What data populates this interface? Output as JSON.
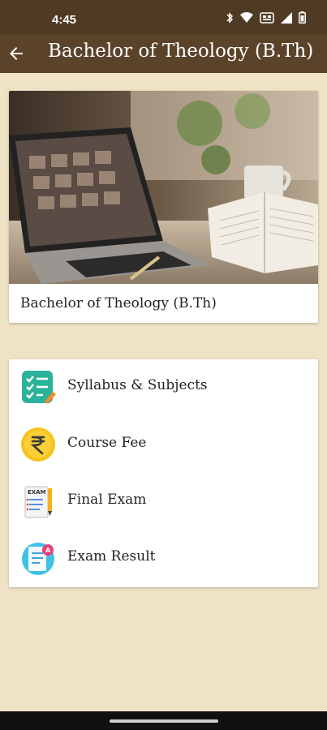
{
  "status_bar": {
    "time": "4:45"
  },
  "app_bar": {
    "title": "Bachelor of Theology (B.Th)",
    "back_icon": "arrow-back-icon"
  },
  "course_card": {
    "caption": "Bachelor of Theology (B.Th)"
  },
  "menu": {
    "items": [
      {
        "label": "Syllabus & Subjects",
        "icon": "checklist-icon"
      },
      {
        "label": "Course Fee",
        "icon": "rupee-coin-icon"
      },
      {
        "label": "Final Exam",
        "icon": "exam-paper-icon"
      },
      {
        "label": "Exam Result",
        "icon": "result-document-icon"
      }
    ]
  },
  "colors": {
    "status_bar": "#4f3a24",
    "app_bar": "#5b432a",
    "background": "#efe3c6",
    "card": "#ffffff"
  }
}
